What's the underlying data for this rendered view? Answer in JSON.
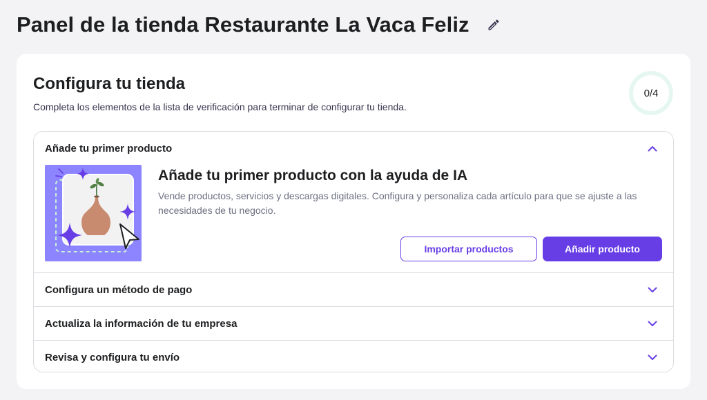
{
  "header": {
    "title": "Panel de la tienda Restaurante La Vaca Feliz",
    "edit_icon": "pencil-icon"
  },
  "setup": {
    "title": "Configura tu tienda",
    "subtitle": "Completa los elementos de la lista de verificación para terminar de configurar tu tienda.",
    "progress": "0/4",
    "progress_fraction": 0,
    "items": [
      {
        "label": "Añade tu primer producto",
        "expanded": true,
        "detail_title": "Añade tu primer producto con la ayuda de IA",
        "detail_description": "Vende productos, servicios y descargas digitales. Configura y personaliza cada artículo para que se ajuste a las necesidades de tu negocio.",
        "secondary_button": "Importar productos",
        "primary_button": "Añadir producto"
      },
      {
        "label": "Configura un método de pago",
        "expanded": false
      },
      {
        "label": "Actualiza la información de tu empresa",
        "expanded": false
      },
      {
        "label": "Revisa y configura tu envío",
        "expanded": false
      }
    ]
  },
  "colors": {
    "accent": "#673de6",
    "illustration_bg": "#8c85ff",
    "progress_track": "#e6f7f1",
    "page_bg": "#f3f3f6"
  }
}
